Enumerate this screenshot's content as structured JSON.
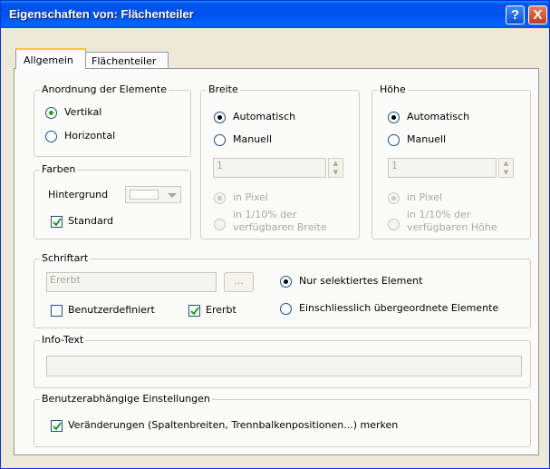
{
  "window": {
    "title": "Eigenschaften von: Flächenteiler",
    "help_label": "?",
    "close_label": "X"
  },
  "tabs": [
    "Allgemein",
    "Flächenteiler"
  ],
  "anordnung": {
    "legend": "Anordnung der Elemente",
    "options": [
      "Vertikal",
      "Horizontal"
    ],
    "selected": "Vertikal"
  },
  "farben": {
    "legend": "Farben",
    "hintergrund_label": "Hintergrund",
    "standard_label": "Standard",
    "standard_checked": true
  },
  "breite": {
    "legend": "Breite",
    "auto_label": "Automatisch",
    "manuell_label": "Manuell",
    "value": "1",
    "pixel_label": "in Pixel",
    "percent_label_1": "in 1/10% der",
    "percent_label_2": "verfügbaren Breite"
  },
  "hoehe": {
    "legend": "Höhe",
    "auto_label": "Automatisch",
    "manuell_label": "Manuell",
    "value": "1",
    "pixel_label": "in Pixel",
    "percent_label_1": "in 1/10% der",
    "percent_label_2": "verfügbaren Höhe"
  },
  "schriftart": {
    "legend": "Schriftart",
    "value": "Ererbt",
    "browse_label": "...",
    "benutzerdefiniert_label": "Benutzerdefiniert",
    "benutzerdefiniert_checked": false,
    "ererbt_label": "Ererbt",
    "ererbt_checked": true,
    "nur_selektiert_label": "Nur selektiertes Element",
    "einschliesslich_label": "Einschliesslich übergeordnete Elemente"
  },
  "info": {
    "legend": "Info-Text",
    "value": ""
  },
  "benutzer": {
    "legend": "Benutzerabhängige Einstellungen",
    "label": "Veränderungen  (Spaltenbreiten, Trennbalkenpositionen...) merken",
    "checked": true
  },
  "colors": {
    "titlebar": "#0054e3",
    "face": "#ece9d8",
    "panel": "#fbfbf9",
    "radio_dot": "#21a121"
  }
}
